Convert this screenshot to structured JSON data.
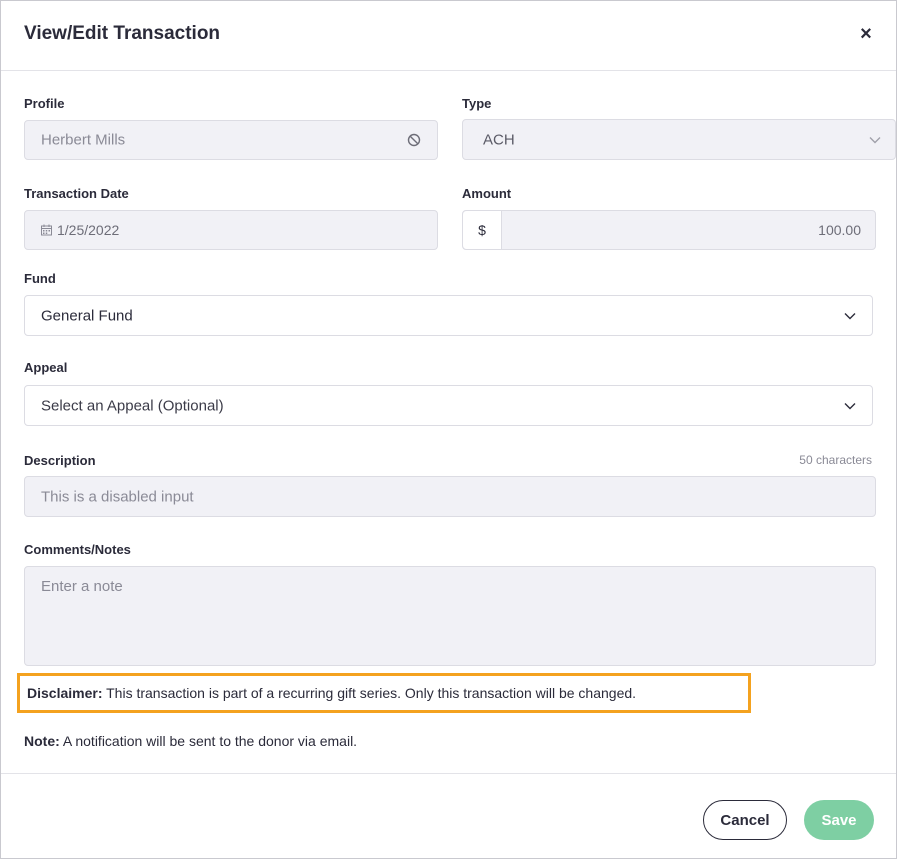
{
  "modal": {
    "title": "View/Edit Transaction",
    "close_label": "×"
  },
  "form": {
    "profile": {
      "label": "Profile",
      "value": "Herbert Mills"
    },
    "type": {
      "label": "Type",
      "value": "ACH"
    },
    "transaction_date": {
      "label": "Transaction Date",
      "value": "1/25/2022"
    },
    "amount": {
      "label": "Amount",
      "currency": "$",
      "value": "100.00"
    },
    "fund": {
      "label": "Fund",
      "value": "General Fund"
    },
    "appeal": {
      "label": "Appeal",
      "placeholder": "Select an Appeal (Optional)"
    },
    "description": {
      "label": "Description",
      "char_limit": "50 characters",
      "placeholder": "This is a disabled input"
    },
    "comments": {
      "label": "Comments/Notes",
      "placeholder": "Enter a note"
    }
  },
  "disclaimer": {
    "prefix": "Disclaimer:",
    "text": " This transaction is part of a recurring gift series. Only this transaction will be changed."
  },
  "note": {
    "prefix": "Note:",
    "text": " A notification will be sent to the donor via email."
  },
  "footer": {
    "cancel_label": "Cancel",
    "save_label": "Save"
  },
  "colors": {
    "highlight": "#f4a21f",
    "save_button": "#7ecfa3",
    "disabled_field": "#f1f1f6"
  },
  "icons": {
    "close": "close-icon",
    "ban": "ban-icon",
    "chevron": "chevron-down-icon",
    "calendar": "calendar-icon"
  }
}
